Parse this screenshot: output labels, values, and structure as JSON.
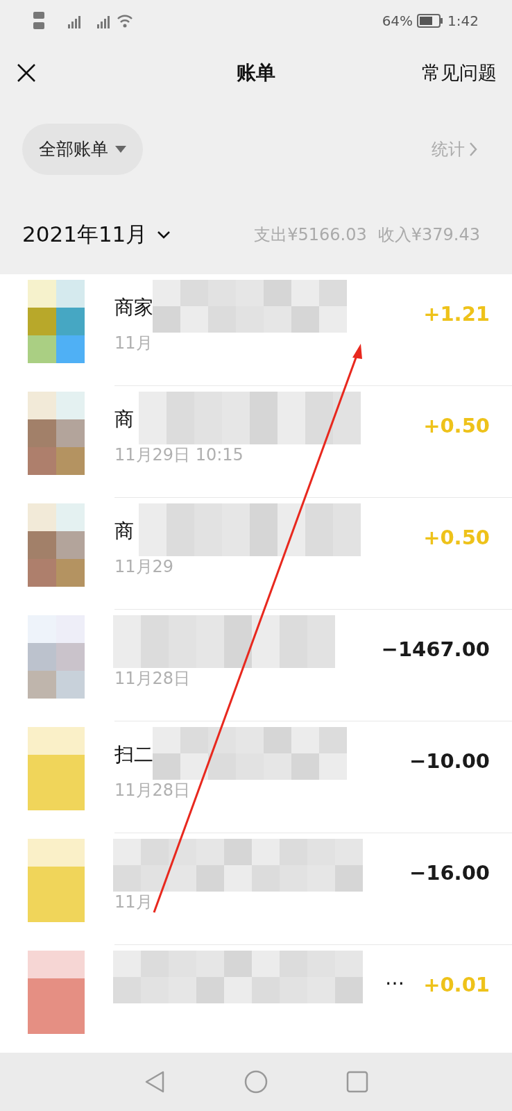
{
  "status_bar": {
    "battery": "64%",
    "time": "1:42"
  },
  "header": {
    "title": "账单",
    "help": "常见问题"
  },
  "filter": {
    "label": "全部账单",
    "stats": "统计"
  },
  "month": {
    "label": "2021年11月",
    "expense": "支出¥5166.03",
    "income": "收入¥379.43"
  },
  "bills": [
    {
      "title": "商家",
      "date": "11月",
      "amount": "+1.21",
      "kind": "income"
    },
    {
      "title": "商",
      "date": "11月29日 10:15",
      "amount": "+0.50",
      "kind": "income"
    },
    {
      "title": "商",
      "date": "11月29",
      "amount": "+0.50",
      "kind": "income"
    },
    {
      "date": "11月28日",
      "amount": "−1467.00",
      "kind": "expense"
    },
    {
      "title": "扫二",
      "date": "11月28日",
      "amount": "−10.00",
      "kind": "expense"
    },
    {
      "date": "11月",
      "amount": "−16.00",
      "kind": "expense"
    },
    {
      "title": "…",
      "amount": "+0.01",
      "kind": "income"
    }
  ]
}
